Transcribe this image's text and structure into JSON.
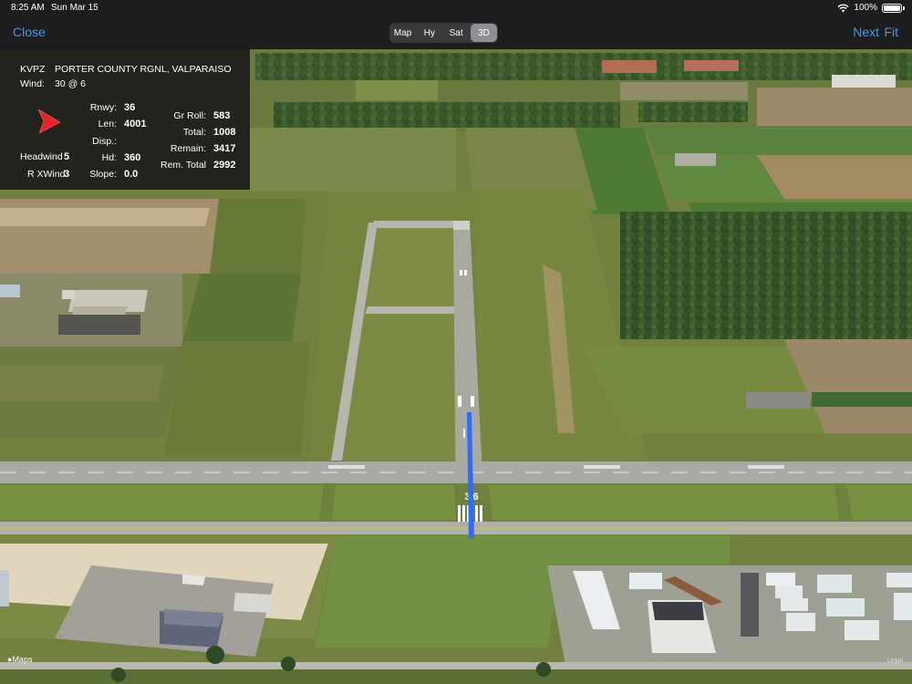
{
  "status_bar": {
    "time": "8:25 AM",
    "date": "Sun Mar 15",
    "battery": "100%"
  },
  "nav": {
    "close_label": "Close",
    "next_label": "Next",
    "fit_label": "Fit",
    "map_types": [
      "Map",
      "Hy",
      "Sat",
      "3D"
    ],
    "selected_map_type": "3D"
  },
  "panel": {
    "airport_id": "KVPZ",
    "airport_name": "PORTER COUNTY RGNL, VALPARAISO",
    "wind_label": "Wind:",
    "wind_value": "30 @ 6",
    "headwind_label": "Headwind",
    "headwind_value": "5",
    "crosswind_label": "R XWind",
    "crosswind_value": "3",
    "rnwy_label": "Rnwy:",
    "rnwy_value": "36",
    "len_label": "Len:",
    "len_value": "4001",
    "disp_label": "Disp.:",
    "disp_value": "",
    "hd_label": "Hd:",
    "hd_value": "360",
    "slope_label": "Slope:",
    "slope_value": "0.0",
    "gr_roll_label": "Gr Roll:",
    "gr_roll_value": "583",
    "total_label": "Total:",
    "total_value": "1008",
    "remain_label": "Remain:",
    "remain_value": "3417",
    "rem_total_label": "Rem. Total",
    "rem_total_value": "2992",
    "wind_arrow_color": "#e8202a"
  },
  "map": {
    "runway_number": "3 6",
    "centerline_color": "#2f6bff",
    "attribution": "Maps",
    "legal": "Legal"
  },
  "colors": {
    "accent": "#3d9bf0",
    "toolbar": "#1d1d1f"
  }
}
